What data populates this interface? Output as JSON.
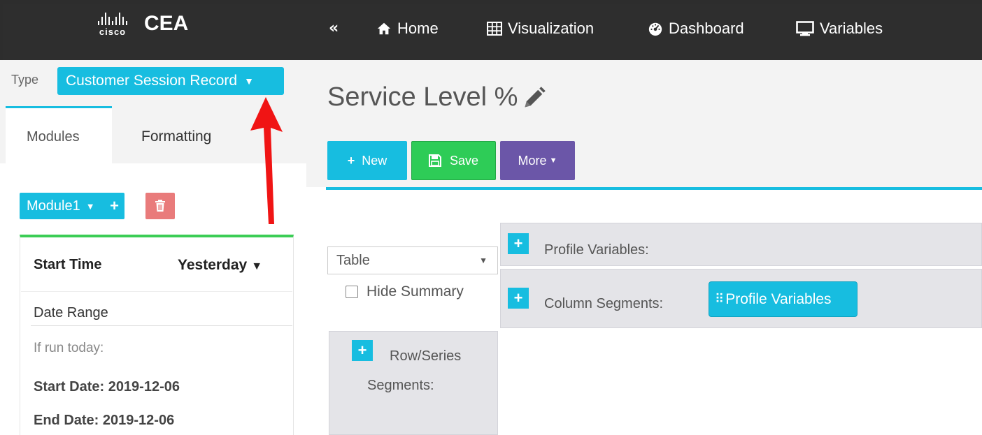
{
  "header": {
    "logo_text": "cisco",
    "app_name": "CEA",
    "collapse_glyph": "«",
    "nav": [
      {
        "label": "Home",
        "icon": "home-icon"
      },
      {
        "label": "Visualization",
        "icon": "table-icon"
      },
      {
        "label": "Dashboard",
        "icon": "dashboard-icon"
      },
      {
        "label": "Variables",
        "icon": "monitor-icon"
      }
    ]
  },
  "sidebar": {
    "type_label": "Type",
    "type_value": "Customer Session Record",
    "tabs": [
      {
        "label": "Modules",
        "active": true
      },
      {
        "label": "Formatting",
        "active": false
      }
    ],
    "module_label": "Module1",
    "start_time_label": "Start Time",
    "start_time_value": "Yesterday",
    "date_range_label": "Date Range",
    "if_run_today": "If run today:",
    "start_date": "Start Date: 2019-12-06",
    "end_date": "End Date: 2019-12-06"
  },
  "main": {
    "title": "Service Level %",
    "toolbar": {
      "new_label": "New",
      "save_label": "Save",
      "more_label": "More"
    },
    "viz_type": "Table",
    "hide_summary_label": "Hide Summary",
    "hide_summary_checked": false,
    "profile_variables_label": "Profile Variables:",
    "column_segments_label": "Column Segments:",
    "column_segment_chip": "Profile Variables",
    "row_segments_label_1": "Row/Series",
    "row_segments_label_2": "Segments:"
  },
  "colors": {
    "accent": "#17bde0",
    "save_green": "#2ecc57",
    "more_purple": "#6b56a8",
    "delete_red": "#e97b7b",
    "topbar": "#2e2e2e",
    "annotation_arrow": "#f01414"
  }
}
